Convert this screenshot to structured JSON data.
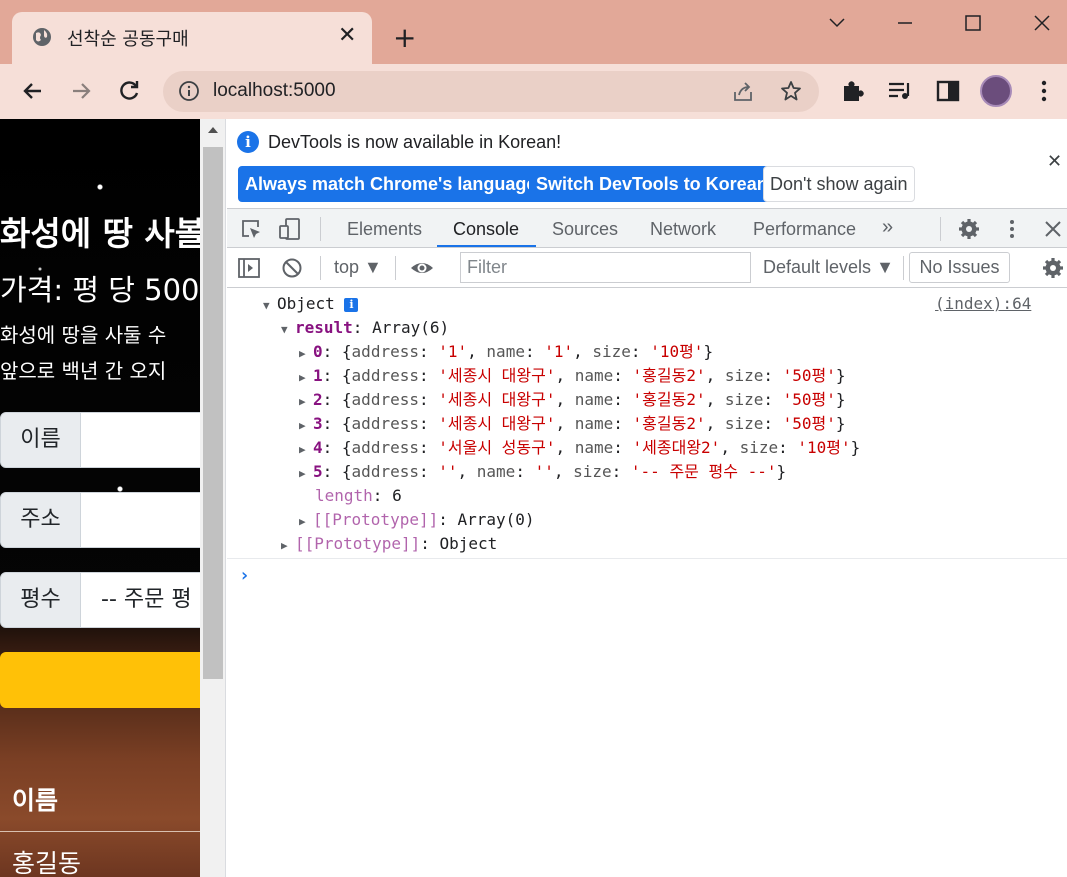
{
  "browser": {
    "tab_title": "선착순 공동구매",
    "url": "localhost:5000",
    "colors": {
      "frame": "#e2a898",
      "toolbar": "#f6dfd8",
      "accent": "#1a73e8"
    }
  },
  "webpage": {
    "heading": "화성에 땅 사볼",
    "price": "가격: 평 당 500",
    "desc_line1": "화성에 땅을 사둘 수",
    "desc_line2": "앞으로 백년 간 오지",
    "form": {
      "name_label": "이름",
      "address_label": "주소",
      "size_label": "평수",
      "size_value": "-- 주문 평"
    },
    "list_header": "이름",
    "list_first": "홍길동"
  },
  "devtools": {
    "infobar": {
      "message": "DevTools is now available in Korean!",
      "btn_match": "Always match Chrome's language",
      "btn_switch": "Switch DevTools to Korean",
      "btn_dismiss": "Don't show again"
    },
    "tabs": [
      "Elements",
      "Console",
      "Sources",
      "Network",
      "Performance"
    ],
    "active_tab": "Console",
    "console_bar": {
      "context": "top",
      "filter_placeholder": "Filter",
      "levels": "Default levels",
      "issues": "No Issues"
    },
    "log": {
      "source": "(index):64",
      "root_label": "Object",
      "result_key": "result",
      "result_type": "Array(6)",
      "items": [
        {
          "index": "0",
          "address": "'1'",
          "name": "'1'",
          "size": "'10평'"
        },
        {
          "index": "1",
          "address": "'세종시 대왕구'",
          "name": "'홍길동2'",
          "size": "'50평'"
        },
        {
          "index": "2",
          "address": "'세종시 대왕구'",
          "name": "'홍길동2'",
          "size": "'50평'"
        },
        {
          "index": "3",
          "address": "'세종시 대왕구'",
          "name": "'홍길동2'",
          "size": "'50평'"
        },
        {
          "index": "4",
          "address": "'서울시 성동구'",
          "name": "'세종대왕2'",
          "size": "'10평'"
        },
        {
          "index": "5",
          "address": "''",
          "name": "''",
          "size": "'-- 주문 평수 --'"
        }
      ],
      "length_key": "length",
      "length_value": "6",
      "proto_array": "Array(0)",
      "proto_object": "Object",
      "proto_key": "[[Prototype]]"
    }
  }
}
